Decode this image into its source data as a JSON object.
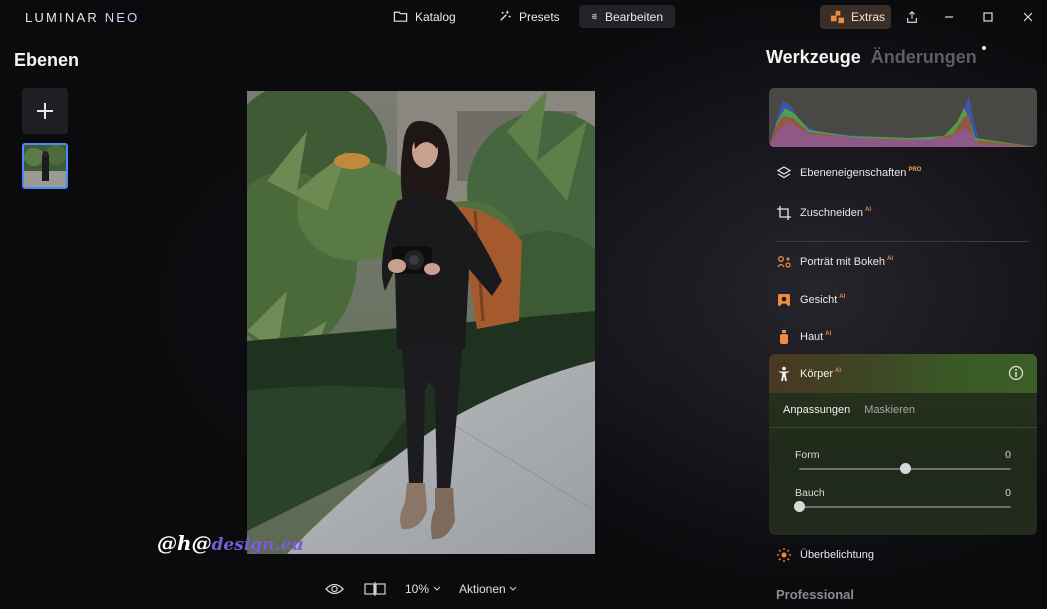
{
  "app": {
    "logo_main": "LUMINAR ",
    "logo_neo": "NEO"
  },
  "nav": {
    "katalog": "Katalog",
    "presets": "Presets",
    "bearbeiten": "Bearbeiten",
    "active": "Bearbeiten"
  },
  "extras": {
    "label": "Extras"
  },
  "left_panel": {
    "title": "Ebenen"
  },
  "watermark": {
    "prefix": "@h@",
    "suffix": "design.eu"
  },
  "bottom_bar": {
    "zoom": "10%",
    "actions": "Aktionen"
  },
  "right_panel": {
    "tab_tools": "Werkzeuge",
    "tab_changes": "Änderungen",
    "tools": [
      {
        "label": "Ebeneneigenschaften",
        "badge": "PRO",
        "icon": "layers-icon"
      },
      {
        "label": "Zuschneiden",
        "badge": "AI",
        "icon": "crop-icon"
      },
      {
        "label": "Porträt mit Bokeh",
        "badge": "AI",
        "icon": "bokeh-icon"
      },
      {
        "label": "Gesicht",
        "badge": "AI",
        "icon": "face-icon"
      },
      {
        "label": "Haut",
        "badge": "AI",
        "icon": "skin-icon"
      }
    ],
    "koerper": {
      "label": "Körper",
      "badge": "AI",
      "subtab_active": "Anpassungen",
      "subtab": "Maskieren",
      "sliders": [
        {
          "label": "Form",
          "value": "0",
          "level": 0.5
        },
        {
          "label": "Bauch",
          "value": "0",
          "level": 0.0
        }
      ]
    },
    "after_tools": [
      {
        "label": "Überbelichtung",
        "icon": "overexposure-icon"
      }
    ],
    "section": "Professional"
  },
  "colors": {
    "accent_blue": "#4a8bf5",
    "extras_orange": "#f08a3e",
    "ai_badge": "#d88b54",
    "pro_badge": "#f1a64a"
  }
}
